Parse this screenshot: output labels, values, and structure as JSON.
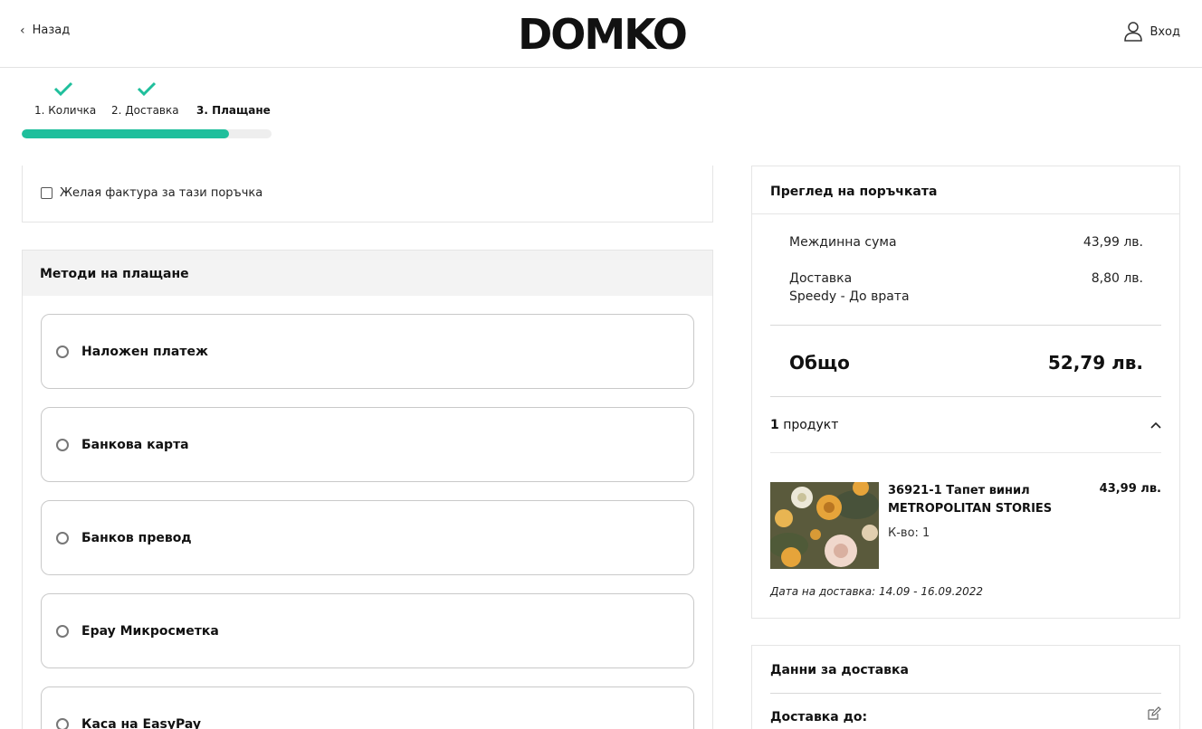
{
  "header": {
    "back_label": "Назад",
    "logo_text": "DOMKO",
    "login_label": "Вход"
  },
  "steps": {
    "items": [
      {
        "label": "1. Количка",
        "done": true
      },
      {
        "label": "2. Доставка",
        "done": true
      },
      {
        "label": "3. Плащане",
        "active": true
      }
    ],
    "progress": 0.83,
    "colors": {
      "accent": "#1fbf9c",
      "track": "#eeeeee"
    }
  },
  "invoice": {
    "label": "Желая фактура за тази поръчка",
    "checked": false
  },
  "payment": {
    "title": "Методи на плащане",
    "methods": [
      {
        "label": "Наложен платеж"
      },
      {
        "label": "Банкова карта"
      },
      {
        "label": "Банков превод"
      },
      {
        "label": "Epay Микросметка"
      },
      {
        "label": "Каса на EasyPay"
      }
    ]
  },
  "summary": {
    "title": "Преглед на поръчката",
    "subtotal_label": "Междинна сума",
    "subtotal_value": "43,99 лв.",
    "shipping_label": "Доставка",
    "shipping_method": "Speedy - До врата",
    "shipping_value": "8,80 лв.",
    "total_label": "Общо",
    "total_value": "52,79 лв.",
    "products_count": "1",
    "products_word": "продукт",
    "product": {
      "name": "36921-1 Тапет винил METROPOLITAN STORIES",
      "price": "43,99 лв.",
      "qty": "К-во: 1",
      "delivery_date": "Дата на доставка: 14.09 - 16.09.2022"
    }
  },
  "delivery": {
    "title": "Данни за доставка",
    "to_label": "Доставка до:"
  }
}
